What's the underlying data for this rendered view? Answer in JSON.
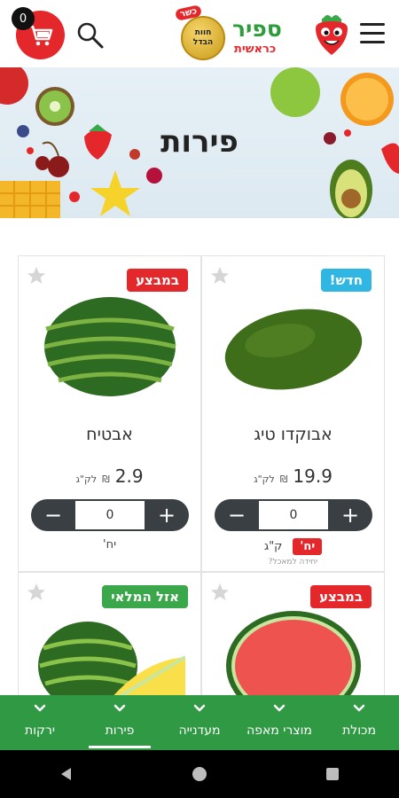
{
  "header": {
    "cart_count": "0",
    "logo_name": "ספיר",
    "logo_sub": "כראשית",
    "kosher_tag": "כשר",
    "kosher_seal_line1": "חוות",
    "kosher_seal_line2": "הבדל"
  },
  "banner": {
    "title": "פירות"
  },
  "products": [
    {
      "name": "אבוקדו טיג",
      "badge": "חדש!",
      "badge_color": "#2fb6e3",
      "price": "19.9",
      "currency": "₪",
      "unit": "לק\"ג",
      "qty": "0",
      "unit_options": [
        "יח'",
        "ק\"ג"
      ],
      "unit_note": "יחידה למאכל?"
    },
    {
      "name": "אבטיח",
      "badge": "במבצע",
      "badge_color": "#e4272b",
      "price": "2.9",
      "currency": "₪",
      "unit": "לק\"ג",
      "qty": "0",
      "unit_options": [
        "יח'"
      ]
    },
    {
      "badge": "במבצע",
      "badge_color": "#e4272b"
    },
    {
      "badge": "אזל המלאי",
      "badge_color": "#3aa74a"
    }
  ],
  "bottom_nav": [
    {
      "label": "מכולת"
    },
    {
      "label": "מוצרי מאפה"
    },
    {
      "label": "מעדנייה"
    },
    {
      "label": "פירות"
    },
    {
      "label": "ירקות"
    }
  ],
  "colors": {
    "brand_red": "#e4272b",
    "brand_green": "#2f9a43",
    "qty_dark": "#3a3f44"
  }
}
